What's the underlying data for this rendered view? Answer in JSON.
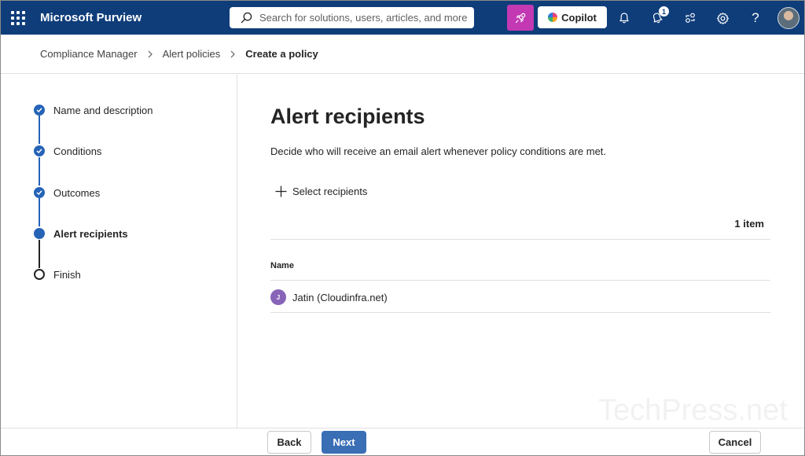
{
  "header": {
    "app_name": "Microsoft Purview",
    "search_placeholder": "Search for solutions, users, articles, and more",
    "copilot_label": "Copilot",
    "notification_count": "1",
    "help_glyph": "?",
    "icons": [
      "waffle-icon",
      "search-icon",
      "rocket-icon",
      "bell-icon",
      "alert-bell-icon",
      "connections-icon",
      "gear-icon",
      "help-icon"
    ],
    "colors": {
      "bar": "#0f3d7a",
      "rocket": "#c239b3"
    }
  },
  "breadcrumb": {
    "items": [
      "Compliance Manager",
      "Alert policies",
      "Create a policy"
    ]
  },
  "wizard": {
    "steps": [
      {
        "label": "Name and description",
        "state": "completed"
      },
      {
        "label": "Conditions",
        "state": "completed"
      },
      {
        "label": "Outcomes",
        "state": "completed"
      },
      {
        "label": "Alert recipients",
        "state": "current"
      },
      {
        "label": "Finish",
        "state": "pending"
      }
    ],
    "accent_color": "#2563b7"
  },
  "main": {
    "title": "Alert recipients",
    "description": "Decide who will receive an email alert whenever policy conditions are met.",
    "select_label": "Select recipients",
    "item_count": "1 item",
    "table": {
      "column_header": "Name",
      "rows": [
        {
          "initial": "J",
          "name": "Jatin (Cloudinfra.net)"
        }
      ]
    }
  },
  "footer": {
    "back_label": "Back",
    "next_label": "Next",
    "cancel_label": "Cancel"
  },
  "watermark": "TechPress.net"
}
